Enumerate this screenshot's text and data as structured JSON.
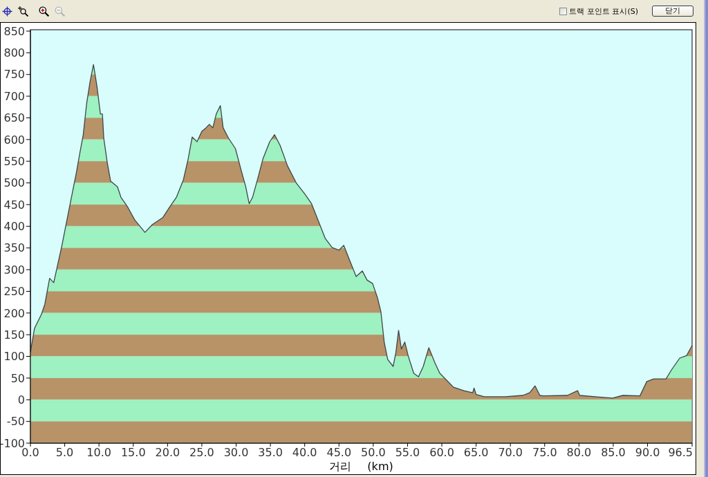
{
  "toolbar": {
    "tools": [
      {
        "kind": "crosshair",
        "disabled": false
      },
      {
        "kind": "zoom-region",
        "disabled": false
      },
      {
        "kind": "zoom-in",
        "disabled": false
      },
      {
        "kind": "zoom-out",
        "disabled": true
      }
    ],
    "checkbox": {
      "label": "트랙 포인트 표시(S)",
      "checked": false
    },
    "buttons": [
      "닫기"
    ]
  },
  "chart": {
    "chart_data": {
      "type": "area",
      "xlabel": "거리 (km)",
      "x": [
        0.0,
        0.6,
        1.6,
        2.1,
        2.8,
        3.4,
        4.6,
        5.7,
        6.7,
        7.2,
        7.7,
        8.2,
        8.7,
        9.2,
        9.7,
        10.2,
        10.5,
        10.7,
        11.2,
        11.7,
        12.7,
        13.2,
        14.2,
        15.2,
        16.7,
        17.8,
        19.3,
        20.3,
        21.3,
        22.3,
        23.0,
        23.6,
        24.3,
        25.0,
        25.6,
        26.1,
        26.6,
        27.1,
        27.7,
        28.1,
        28.9,
        29.9,
        30.7,
        31.4,
        31.9,
        32.4,
        33.1,
        33.9,
        34.9,
        35.6,
        36.4,
        37.5,
        38.8,
        40.0,
        41.0,
        42.0,
        43.0,
        44.0,
        45.0,
        45.7,
        46.5,
        47.5,
        48.4,
        49.1,
        49.9,
        50.6,
        51.1,
        51.6,
        52.1,
        52.9,
        53.3,
        53.7,
        54.1,
        54.6,
        55.1,
        55.9,
        56.6,
        57.3,
        58.1,
        59.0,
        59.7,
        60.7,
        61.7,
        63.2,
        64.5,
        64.7,
        65.0,
        66.2,
        69.2,
        71.8,
        72.8,
        73.6,
        74.3,
        74.8,
        78.3,
        79.8,
        80.1,
        82.4,
        84.9,
        86.4,
        88.9,
        89.9,
        90.9,
        92.7,
        93.5,
        94.7,
        95.7,
        96.5
      ],
      "values": [
        110,
        165,
        197,
        220,
        280,
        270,
        356,
        444,
        523,
        568,
        611,
        683,
        734,
        773,
        723,
        659,
        659,
        603,
        547,
        504,
        491,
        467,
        444,
        415,
        386,
        404,
        420,
        444,
        467,
        507,
        555,
        606,
        595,
        619,
        627,
        635,
        627,
        659,
        678,
        627,
        603,
        579,
        531,
        491,
        452,
        467,
        507,
        555,
        595,
        611,
        587,
        539,
        499,
        475,
        452,
        412,
        372,
        351,
        345,
        356,
        324,
        284,
        297,
        276,
        268,
        236,
        204,
        133,
        93,
        77,
        109,
        160,
        117,
        133,
        101,
        61,
        53,
        77,
        120,
        85,
        61,
        45,
        29,
        21,
        16,
        27,
        12,
        7,
        7,
        10,
        16,
        32,
        10,
        9,
        10,
        21,
        10,
        7,
        4,
        10,
        9,
        42,
        48,
        48,
        69,
        96,
        102,
        125
      ],
      "xlim": [
        0,
        96.5
      ],
      "ylim": [
        -100,
        850
      ],
      "xticks": [
        {
          "value": 0,
          "label": "0.0"
        },
        {
          "value": 5,
          "label": "5.0"
        },
        {
          "value": 10,
          "label": "10.0"
        },
        {
          "value": 15,
          "label": "15.0"
        },
        {
          "value": 20,
          "label": "20.0"
        },
        {
          "value": 25,
          "label": "25.0"
        },
        {
          "value": 30,
          "label": "30.0"
        },
        {
          "value": 35,
          "label": "35.0"
        },
        {
          "value": 40,
          "label": "40.0"
        },
        {
          "value": 45,
          "label": "45.0"
        },
        {
          "value": 50,
          "label": "50.0"
        },
        {
          "value": 55,
          "label": "55.0"
        },
        {
          "value": 60,
          "label": "60.0"
        },
        {
          "value": 65,
          "label": "65.0"
        },
        {
          "value": 70,
          "label": "70.0"
        },
        {
          "value": 75,
          "label": "75.0"
        },
        {
          "value": 80,
          "label": "80.0"
        },
        {
          "value": 85,
          "label": "85.0"
        },
        {
          "value": 90,
          "label": "90.0"
        },
        {
          "value": 96.5,
          "label": "96.5"
        }
      ],
      "yticks": [
        -100,
        -50,
        0,
        50,
        100,
        150,
        200,
        250,
        300,
        350,
        400,
        450,
        500,
        550,
        600,
        650,
        700,
        750,
        800,
        850
      ]
    }
  }
}
